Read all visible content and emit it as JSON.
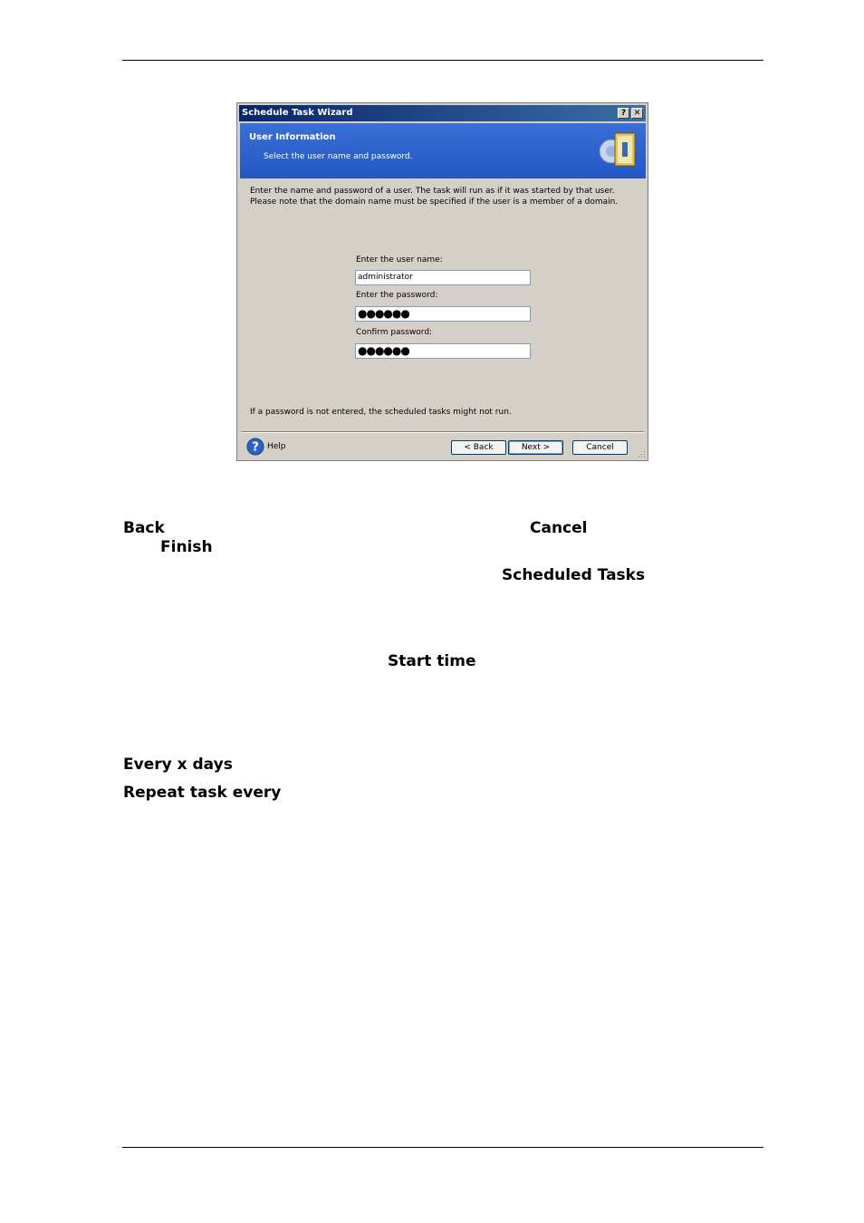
{
  "dialog": {
    "title": "Schedule Task Wizard",
    "help_glyph": "?",
    "close_glyph": "✕",
    "header_title": "User Information",
    "header_subtitle": "Select the user name and password.",
    "header_icon": "server-clock-icon",
    "intro": "Enter the name and password of a user. The task will run as if it was started by that user. Please note that the domain name must be specified if the user is a member of a domain.",
    "username_label": "Enter the user name:",
    "username_value": "administrator",
    "password_label": "Enter the password:",
    "password_value": "●●●●●●",
    "confirm_label": "Confirm password:",
    "confirm_value": "●●●●●●",
    "note": "If a password is not entered, the scheduled tasks might not run.",
    "help_label": "Help",
    "back_label": "< Back",
    "next_label": "Next >",
    "cancel_label": "Cancel"
  },
  "doc": {
    "back": "Back",
    "cancel": "Cancel",
    "finish": "Finish",
    "scheduled_tasks": "Scheduled Tasks",
    "start_time": "Start time",
    "every_x_days": "Every x days",
    "repeat_task_every": "Repeat task every"
  },
  "colors": {
    "title_bar": "#0a246a",
    "header_band": "#2a5dc7",
    "dialog_face": "#d4d0c8"
  }
}
